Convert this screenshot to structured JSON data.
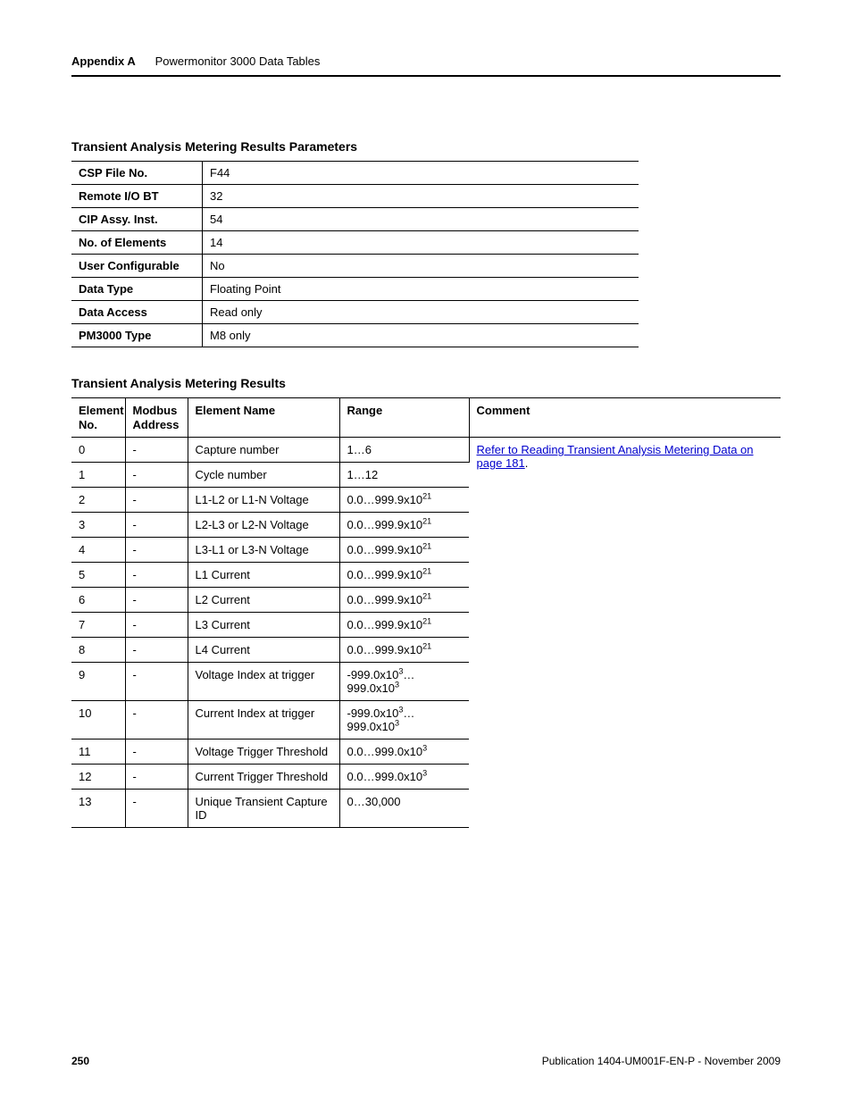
{
  "header": {
    "appendix": "Appendix A",
    "title": "Powermonitor 3000 Data Tables"
  },
  "params": {
    "heading": "Transient Analysis Metering Results Parameters",
    "rows": [
      {
        "k": "CSP File No.",
        "v": "F44"
      },
      {
        "k": "Remote I/O BT",
        "v": "32"
      },
      {
        "k": "CIP Assy. Inst.",
        "v": "54"
      },
      {
        "k": "No. of Elements",
        "v": "14"
      },
      {
        "k": "User Configurable",
        "v": "No"
      },
      {
        "k": "Data Type",
        "v": "Floating Point"
      },
      {
        "k": "Data Access",
        "v": "Read only"
      },
      {
        "k": "PM3000 Type",
        "v": "M8 only"
      }
    ]
  },
  "results": {
    "heading": "Transient Analysis Metering Results",
    "headers": {
      "el": "Element No.",
      "mb": "Modbus Address",
      "name": "Element Name",
      "range": "Range",
      "comment": "Comment"
    },
    "comment_link_text": "Refer to Reading Transient Analysis Metering Data on page 181",
    "comment_suffix": ".",
    "rows": [
      {
        "el": "0",
        "mb": "-",
        "name": "Capture number",
        "range_html": "1…6"
      },
      {
        "el": "1",
        "mb": "-",
        "name": "Cycle number",
        "range_html": "1…12"
      },
      {
        "el": "2",
        "mb": "-",
        "name": "L1-L2 or L1-N Voltage",
        "range_html": "0.0…999.9x10<sup>21</sup>"
      },
      {
        "el": "3",
        "mb": "-",
        "name": "L2-L3 or L2-N Voltage",
        "range_html": "0.0…999.9x10<sup>21</sup>"
      },
      {
        "el": "4",
        "mb": "-",
        "name": "L3-L1 or L3-N Voltage",
        "range_html": "0.0…999.9x10<sup>21</sup>"
      },
      {
        "el": "5",
        "mb": "-",
        "name": "L1 Current",
        "range_html": "0.0…999.9x10<sup>21</sup>"
      },
      {
        "el": "6",
        "mb": "-",
        "name": "L2 Current",
        "range_html": "0.0…999.9x10<sup>21</sup>"
      },
      {
        "el": "7",
        "mb": "-",
        "name": "L3 Current",
        "range_html": "0.0…999.9x10<sup>21</sup>"
      },
      {
        "el": "8",
        "mb": "-",
        "name": "L4 Current",
        "range_html": "0.0…999.9x10<sup>21</sup>"
      },
      {
        "el": "9",
        "mb": "-",
        "name": "Voltage Index at trigger",
        "range_html": "-999.0x10<sup>3</sup>…999.0x10<sup>3</sup>"
      },
      {
        "el": "10",
        "mb": "-",
        "name": "Current Index at trigger",
        "range_html": "-999.0x10<sup>3</sup>…999.0x10<sup>3</sup>"
      },
      {
        "el": "11",
        "mb": "-",
        "name": "Voltage Trigger Threshold",
        "range_html": "0.0…999.0x10<sup>3</sup>"
      },
      {
        "el": "12",
        "mb": "-",
        "name": "Current Trigger Threshold",
        "range_html": "0.0…999.0x10<sup>3</sup>"
      },
      {
        "el": "13",
        "mb": "-",
        "name": "Unique Transient Capture ID",
        "range_html": "0…30,000"
      }
    ]
  },
  "footer": {
    "page_no": "250",
    "pub": "Publication 1404-UM001F-EN-P - November 2009"
  }
}
